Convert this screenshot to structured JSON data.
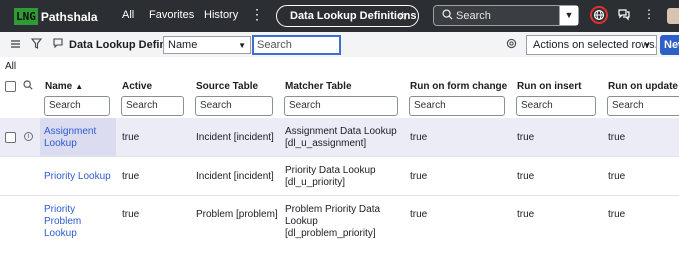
{
  "topnav": {
    "logo_badge": "LNG",
    "logo_text": "Pathshala",
    "menu": [
      "All",
      "Favorites",
      "History"
    ],
    "more_glyph": "⋮",
    "current_page": "Data Lookup Definitions",
    "star_glyph": "☆",
    "search_placeholder": "Search",
    "search_dropdown_glyph": "▼",
    "more2_glyph": "⋮",
    "icons": [
      "globe-icon",
      "chat-icon",
      "avatar"
    ]
  },
  "toolbar": {
    "title": "Data Lookup Definitions",
    "field_select": "Name",
    "search_value": "Search",
    "actions": "Actions on selected rows...",
    "new_label": "New",
    "dropdown_glyph": "▼"
  },
  "breadcrumb": "All",
  "table": {
    "columns": [
      "Name",
      "Active",
      "Source Table",
      "Matcher Table",
      "Run on form change",
      "Run on insert",
      "Run on update"
    ],
    "sort_glyph": "▲",
    "filter_placeholder": "Search",
    "rows": [
      {
        "name": "Assignment Lookup",
        "active": "true",
        "source": "Incident [incident]",
        "matcher": "Assignment Data Lookup [dl_u_assignment]",
        "form_change": "true",
        "insert": "true",
        "update": "true"
      },
      {
        "name": "Priority Lookup",
        "active": "true",
        "source": "Incident [incident]",
        "matcher": "Priority Data Lookup [dl_u_priority]",
        "form_change": "true",
        "insert": "true",
        "update": "true"
      },
      {
        "name": "Priority Problem Lookup",
        "active": "true",
        "source": "Problem [problem]",
        "matcher": "Problem Priority Data Lookup [dl_problem_priority]",
        "form_change": "true",
        "insert": "true",
        "update": "true"
      }
    ]
  },
  "colors": {
    "nav_bg": "#2b2f33",
    "link": "#2c5bd0",
    "accent": "#2e5fc7",
    "selected_row": "#ececf6"
  }
}
